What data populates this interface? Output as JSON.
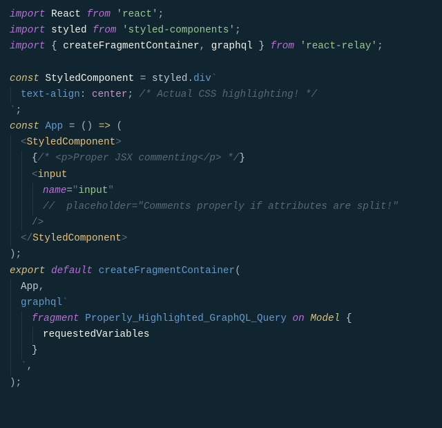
{
  "code": {
    "line1": {
      "import": "import",
      "React": "React",
      "from": "from",
      "pkg": "'react'",
      "semi": ";"
    },
    "line2": {
      "import": "import",
      "styled": "styled",
      "from": "from",
      "pkg": "'styled-components'",
      "semi": ";"
    },
    "line3": {
      "import": "import",
      "lb": "{",
      "a": "createFragmentContainer",
      "comma": ",",
      "b": "graphql",
      "rb": "}",
      "from": "from",
      "pkg": "'react-relay'",
      "semi": ";"
    },
    "line5": {
      "const": "const",
      "name": "StyledComponent",
      "eq": "=",
      "obj": "styled",
      "dot": ".",
      "method": "div",
      "tick": "`"
    },
    "line6": {
      "prop": "text-align",
      "colon": ":",
      "val": "center",
      "semi": ";",
      "comment": "/* Actual CSS highlighting! */"
    },
    "line7": {
      "tick": "`",
      "semi": ";"
    },
    "line8": {
      "const": "const",
      "name": "App",
      "eq": "=",
      "lp": "(",
      "rp": ")",
      "arrow": "=>",
      "open": "("
    },
    "line9": {
      "lt": "<",
      "tag": "StyledComponent",
      "gt": ">"
    },
    "line10": {
      "open": "{",
      "comment": "/* <p>Proper JSX commenting</p> */",
      "close": "}"
    },
    "line11": {
      "lt": "<",
      "tag": "input"
    },
    "line12": {
      "attr": "name",
      "eq": "=",
      "q1": "\"",
      "val": "input",
      "q2": "\""
    },
    "line13": {
      "comment": "//  placeholder=\"Comments properly if attributes are split!\""
    },
    "line14": {
      "slash": "/",
      "gt": ">"
    },
    "line15": {
      "lt": "<",
      "slash": "/",
      "tag": "StyledComponent",
      "gt": ">"
    },
    "line16": {
      "close": ")",
      "semi": ";"
    },
    "line17": {
      "export": "export",
      "default": "default",
      "fn": "createFragmentContainer",
      "open": "("
    },
    "line18": {
      "arg": "App",
      "comma": ","
    },
    "line19": {
      "tag": "graphql",
      "tick": "`"
    },
    "line20": {
      "kw": "fragment",
      "name": "Properly_Highlighted_GraphQL_Query",
      "on": "on",
      "type": "Model",
      "open": "{"
    },
    "line21": {
      "field": "requestedVariables"
    },
    "line22": {
      "close": "}"
    },
    "line23": {
      "tick": "`",
      "comma": ","
    },
    "line24": {
      "close": ")",
      "semi": ";"
    }
  }
}
